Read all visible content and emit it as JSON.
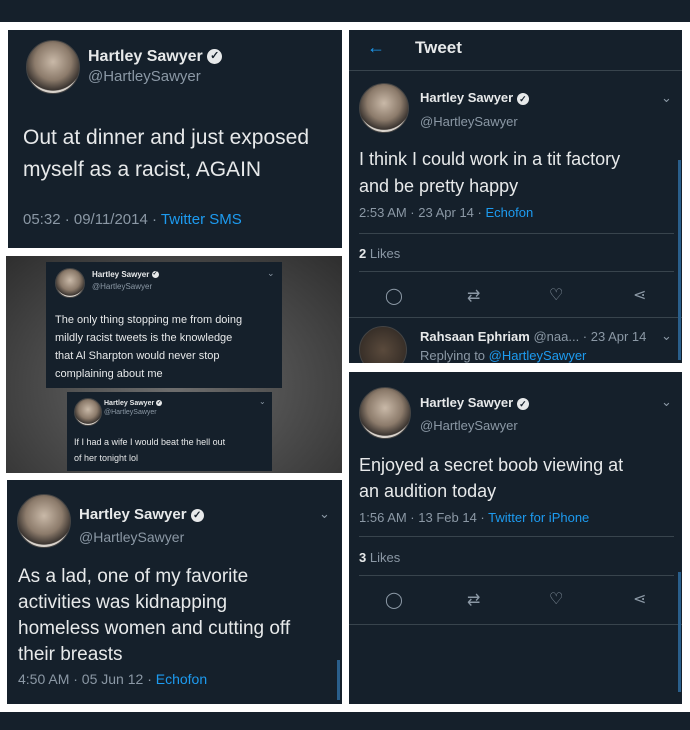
{
  "tweet1": {
    "name": "Hartley Sawyer",
    "handle": "@HartleySawyer",
    "text_lines": [
      "Out at dinner and just exposed",
      "myself as a racist, AGAIN"
    ],
    "time": "05:32 · 09/11/2014 · ",
    "source": "Twitter SMS"
  },
  "tweet2": {
    "header_title": "Tweet",
    "name": "Hartley Sawyer",
    "handle": "@HartleySawyer",
    "text_lines": [
      "I think I could work in a tit factory",
      "and be pretty happy"
    ],
    "time": "2:53 AM · 23 Apr 14 · ",
    "source": "Echofon",
    "likes_count": "2",
    "likes_label": "Likes",
    "reply_name": "Rahsaan Ephriam",
    "reply_handle_time": "@naa... · 23 Apr 14",
    "replying_to": "Replying to ",
    "replying_handle": "@HartleySawyer"
  },
  "tweet3": {
    "name": "Hartley Sawyer",
    "handle": "@HartleySawyer",
    "text_lines": [
      "The only thing stopping me from doing",
      "mildly racist tweets is the knowledge",
      "that Al Sharpton would never stop",
      "complaining about me"
    ]
  },
  "tweet4": {
    "name": "Hartley Sawyer",
    "handle": "@HartleySawyer",
    "text_lines": [
      "If I had a wife I would beat the hell out",
      "of her tonight lol"
    ]
  },
  "tweet5": {
    "name": "Hartley Sawyer",
    "handle": "@HartleySawyer",
    "text_lines": [
      "As a lad, one of my favorite",
      "activities was kidnapping",
      "homeless women and cutting off",
      "their breasts"
    ],
    "time": "4:50 AM · 05 Jun 12 · ",
    "source": "Echofon"
  },
  "tweet6": {
    "name": "Hartley Sawyer",
    "handle": "@HartleySawyer",
    "text_lines": [
      "Enjoyed a secret boob viewing at",
      "an audition today"
    ],
    "time": "1:56 AM · 13 Feb 14 · ",
    "source": "Twitter for iPhone",
    "likes_count": "3",
    "likes_label": "Likes"
  },
  "colors": {
    "background": "#15202b",
    "accent": "#1d9bf0",
    "muted": "#8b98a5"
  },
  "icons": [
    "back-arrow-icon",
    "verified-icon",
    "chevron-down-icon",
    "reply-icon",
    "retweet-icon",
    "like-icon",
    "share-icon"
  ]
}
